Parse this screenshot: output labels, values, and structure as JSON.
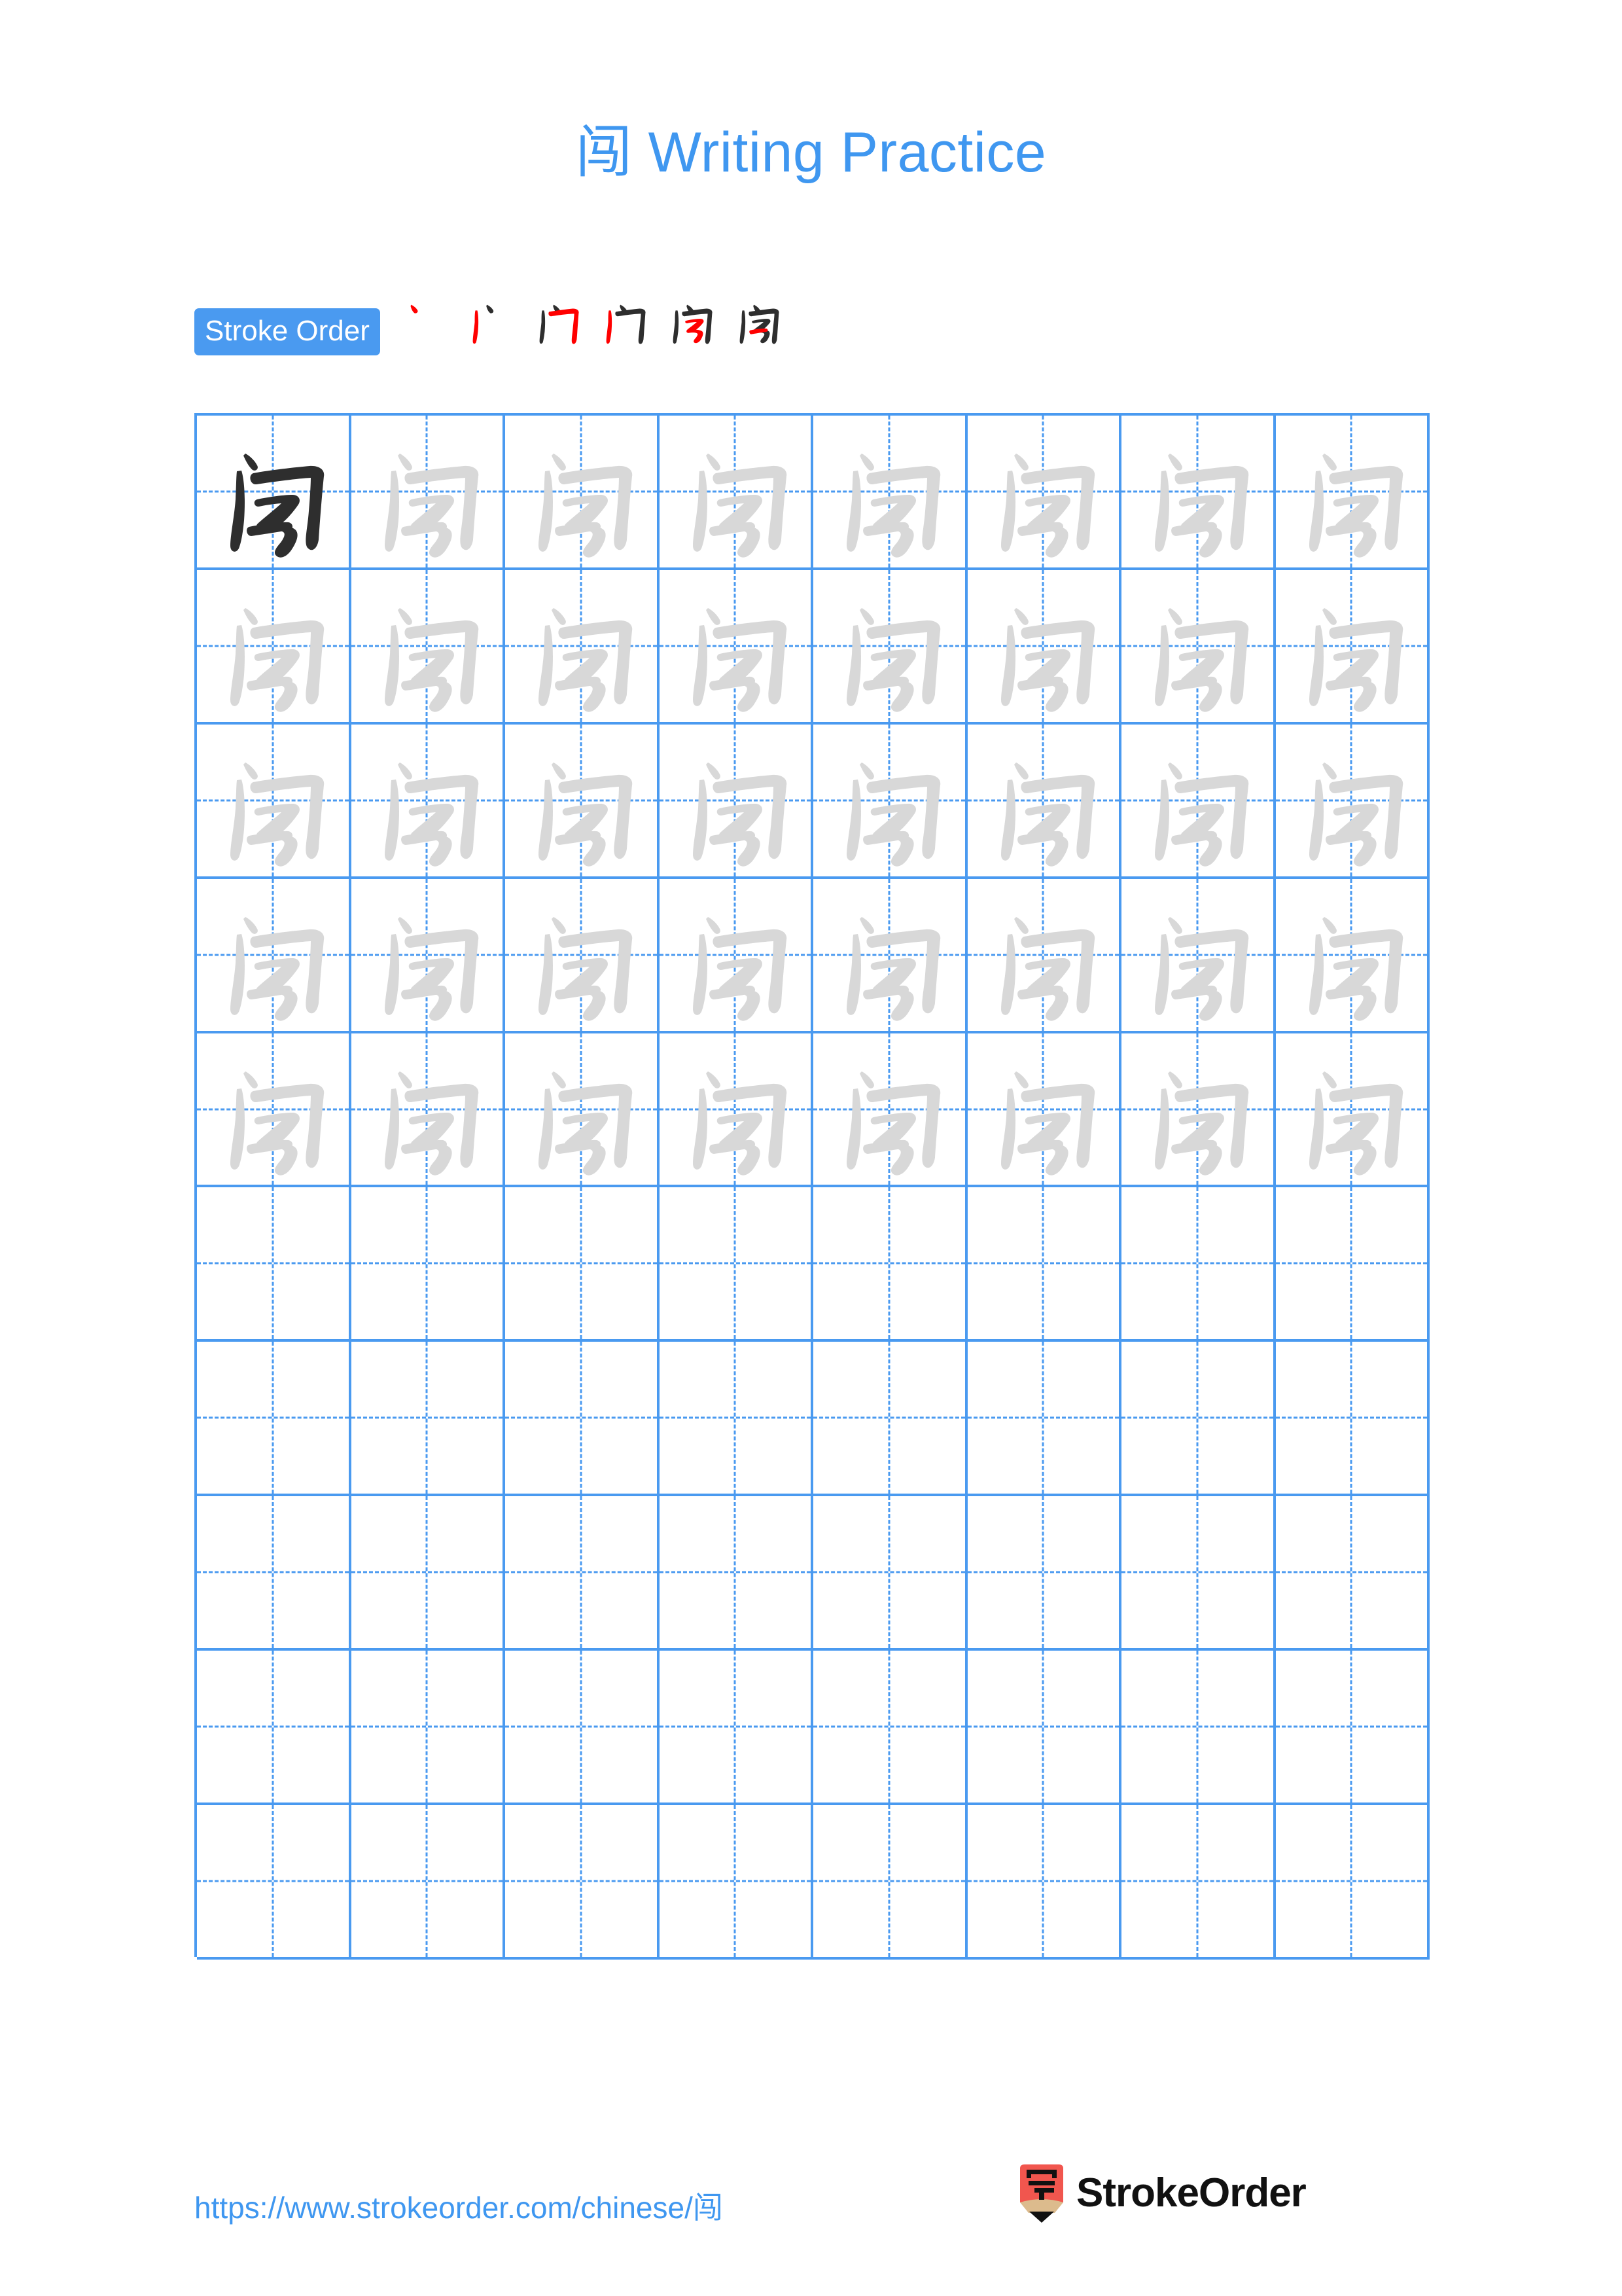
{
  "page": {
    "character": "闯",
    "title_suffix": " Writing Practice",
    "title_full": "闯 Writing Practice",
    "background_color": "#ffffff",
    "accent_color": "#3f97f0",
    "grid_line_color": "#4a9af0",
    "trace_glyph_color": "#d8d8d8",
    "solid_glyph_color": "#2e2e2e",
    "highlight_stroke_color": "#ff0000"
  },
  "stroke_order": {
    "badge_label": "Stroke Order",
    "stroke_count": 6,
    "steps": [
      {
        "index": 1,
        "name": "stroke-step-1",
        "new_stroke": "dot"
      },
      {
        "index": 2,
        "name": "stroke-step-2",
        "new_stroke": "vertical"
      },
      {
        "index": 3,
        "name": "stroke-step-3",
        "new_stroke": "horizontal-hook"
      },
      {
        "index": 4,
        "name": "stroke-step-4",
        "new_stroke": "vertical-hook"
      },
      {
        "index": 5,
        "name": "stroke-step-5",
        "new_stroke": "horse-body"
      },
      {
        "index": 6,
        "name": "stroke-step-6",
        "new_stroke": "horizontal"
      }
    ]
  },
  "grid": {
    "columns": 8,
    "rows": 10,
    "cells": [
      [
        "solid",
        "trace",
        "trace",
        "trace",
        "trace",
        "trace",
        "trace",
        "trace"
      ],
      [
        "trace",
        "trace",
        "trace",
        "trace",
        "trace",
        "trace",
        "trace",
        "trace"
      ],
      [
        "trace",
        "trace",
        "trace",
        "trace",
        "trace",
        "trace",
        "trace",
        "trace"
      ],
      [
        "trace",
        "trace",
        "trace",
        "trace",
        "trace",
        "trace",
        "trace",
        "trace"
      ],
      [
        "trace",
        "trace",
        "trace",
        "trace",
        "trace",
        "trace",
        "trace",
        "trace"
      ],
      [
        "empty",
        "empty",
        "empty",
        "empty",
        "empty",
        "empty",
        "empty",
        "empty"
      ],
      [
        "empty",
        "empty",
        "empty",
        "empty",
        "empty",
        "empty",
        "empty",
        "empty"
      ],
      [
        "empty",
        "empty",
        "empty",
        "empty",
        "empty",
        "empty",
        "empty",
        "empty"
      ],
      [
        "empty",
        "empty",
        "empty",
        "empty",
        "empty",
        "empty",
        "empty",
        "empty"
      ],
      [
        "empty",
        "empty",
        "empty",
        "empty",
        "empty",
        "empty",
        "empty",
        "empty"
      ]
    ]
  },
  "footer": {
    "url": "https://www.strokeorder.com/chinese/闯",
    "brand_name": "StrokeOrder",
    "logo_character": "字",
    "logo_body_color": "#f1564e",
    "logo_wood_color": "#dcbb8d",
    "logo_tip_color": "#111111"
  }
}
